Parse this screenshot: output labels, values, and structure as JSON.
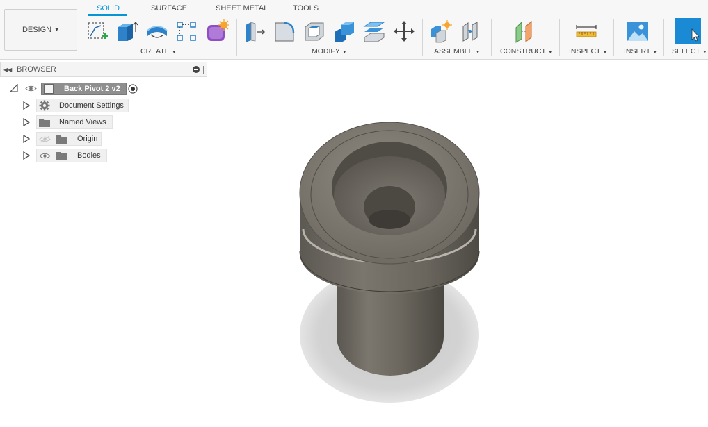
{
  "toolbar": {
    "design_label": "DESIGN",
    "tabs": [
      {
        "label": "SOLID",
        "active": true
      },
      {
        "label": "SURFACE",
        "active": false
      },
      {
        "label": "SHEET METAL",
        "active": false
      },
      {
        "label": "TOOLS",
        "active": false
      }
    ],
    "groups": {
      "create": "CREATE",
      "modify": "MODIFY",
      "assemble": "ASSEMBLE",
      "construct": "CONSTRUCT",
      "inspect": "INSPECT",
      "insert": "INSERT",
      "select": "SELECT"
    }
  },
  "browser": {
    "title": "BROWSER",
    "root": {
      "label": "Back Pivot 2 v2"
    },
    "items": [
      {
        "label": "Document Settings",
        "icon": "gear-icon"
      },
      {
        "label": "Named Views",
        "icon": "folder-icon"
      },
      {
        "label": "Origin",
        "icon": "folder-icon",
        "visible": false
      },
      {
        "label": "Bodies",
        "icon": "folder-icon",
        "visible": true
      }
    ]
  },
  "colors": {
    "accent": "#0696d7",
    "select_tile": "#1a8ad4",
    "body": "#6e6a63",
    "shadow": "#cfcfcf"
  }
}
